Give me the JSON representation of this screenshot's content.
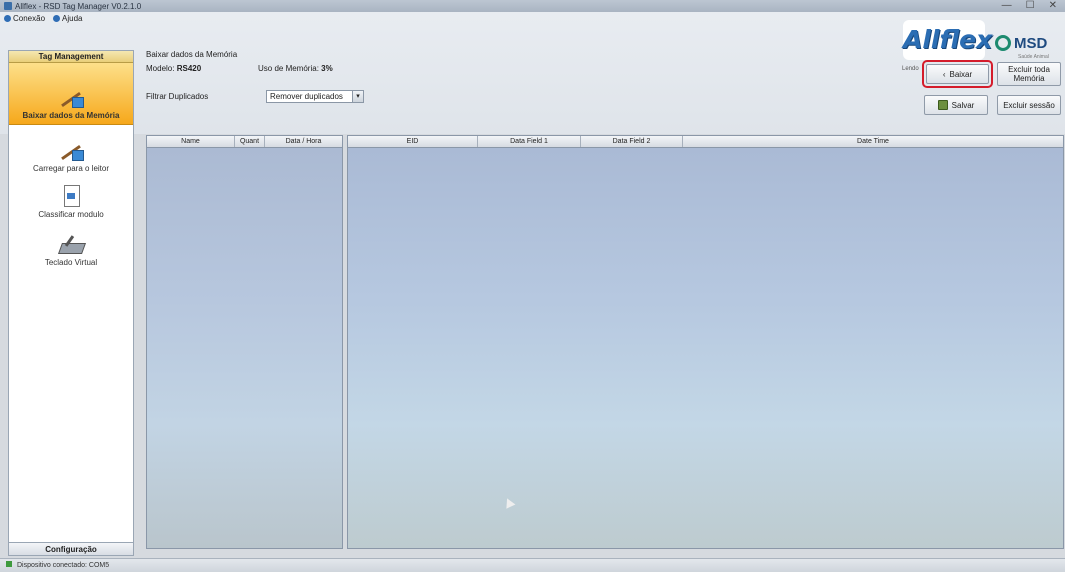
{
  "window": {
    "title": "Allflex - RSD Tag Manager V0.2.1.0",
    "controls": [
      "—",
      "☐",
      "✕"
    ]
  },
  "menu": {
    "items": [
      {
        "label": "Conexão",
        "icon": "connection-icon"
      },
      {
        "label": "Ajuda",
        "icon": "help-icon"
      }
    ]
  },
  "sidebar": {
    "header": "Tag Management",
    "items": [
      {
        "label": "Baixar dados da Memória",
        "icon": "download-pencil-icon",
        "active": true
      },
      {
        "label": "Carregar para o leitor",
        "icon": "upload-pencil-icon",
        "active": false
      },
      {
        "label": "Classificar modulo",
        "icon": "document-icon",
        "active": false
      },
      {
        "label": "Teclado Virtual",
        "icon": "keyboard-icon",
        "active": false
      }
    ],
    "footer": "Configuração"
  },
  "form": {
    "title": "Baixar dados da Memória",
    "model_label": "Modelo:",
    "model_value": "RS420",
    "memory_label": "Uso de Memória:",
    "memory_value": "3%",
    "filter_label": "Filtrar Duplicados",
    "filter_selected": "Remover duplicados"
  },
  "branding": {
    "allflex": "Allflex",
    "msd": "MSD",
    "msd_sub": "Saúde Animal"
  },
  "actions": {
    "lendo_label": "Lendo",
    "baixar": "Baixar",
    "excluir_toda": "Excluir toda Memória",
    "salvar": "Salvar",
    "excluir_sessao": "Excluir sessão",
    "highlight_color": "#d41c2b"
  },
  "table_left": {
    "columns": [
      "Name",
      "Quant",
      "Data / Hora"
    ],
    "rows": []
  },
  "table_right": {
    "columns": [
      "EID",
      "Data Field 1",
      "Data Field 2",
      "Date Time"
    ],
    "rows": []
  },
  "status": {
    "text": "Dispositivo conectado: COM5"
  },
  "colors": {
    "active_item": "#f6a81b",
    "brand_blue": "#2b6db3",
    "msd_green": "#1d8a6f"
  }
}
